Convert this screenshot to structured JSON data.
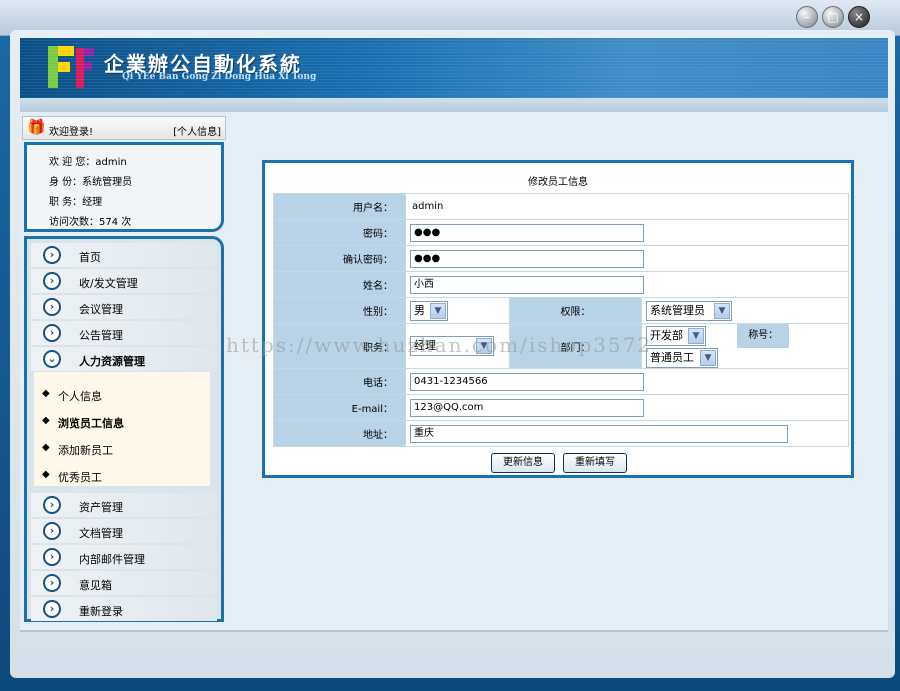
{
  "window": {
    "controls": [
      "–",
      "□",
      "×"
    ]
  },
  "header": {
    "title": "企業辦公自動化系統",
    "subtitle": "Qi YEe Ban Gong Zi Dong Hua Xi Tong"
  },
  "welcome": {
    "greeting": "欢迎登录!",
    "profile_link": "[个人信息]"
  },
  "user": {
    "line1": "欢 迎 您：admin",
    "line2": "身   份：系统管理员",
    "line3": "职   务：经理",
    "line4": "访问次数：574 次"
  },
  "menu": {
    "items": [
      {
        "label": "首页"
      },
      {
        "label": "收/发文管理"
      },
      {
        "label": "会议管理"
      },
      {
        "label": "公告管理"
      },
      {
        "label": "人力资源管理"
      },
      {
        "label": "资产管理"
      },
      {
        "label": "文档管理"
      },
      {
        "label": "内部邮件管理"
      },
      {
        "label": "意见箱"
      },
      {
        "label": "重新登录"
      }
    ],
    "submenu": [
      {
        "label": "个人信息"
      },
      {
        "label": "浏览员工信息"
      },
      {
        "label": "添加新员工"
      },
      {
        "label": "优秀员工"
      }
    ]
  },
  "form": {
    "title": "修改员工信息",
    "username_label": "用户名：",
    "username_value": "admin",
    "password_label": "密码：",
    "password_value": "●●●",
    "confirm_label": "确认密码：",
    "confirm_value": "●●●",
    "name_label": "姓名：",
    "name_value": "小西",
    "gender_label": "性别：",
    "gender_value": "男",
    "permission_label": "权限：",
    "permission_value": "系统管理员",
    "position_label": "职务：",
    "position_value": "经理",
    "department_label": "部门：",
    "department_value": "开发部",
    "rank_label": "称号：",
    "rank_value": "普通员工",
    "phone_label": "电话：",
    "phone_value": "0431-1234566",
    "email_label": "E-mail：",
    "email_value": "123@QQ.com",
    "address_label": "地址：",
    "address_value": "重庆",
    "update_button": "更新信息",
    "reset_button": "重新填写"
  },
  "watermark": "https://www.huzhan.com/ishop3572",
  "colors": {
    "accent": "#1a72ad",
    "label_bg": "#b8d2e6"
  }
}
